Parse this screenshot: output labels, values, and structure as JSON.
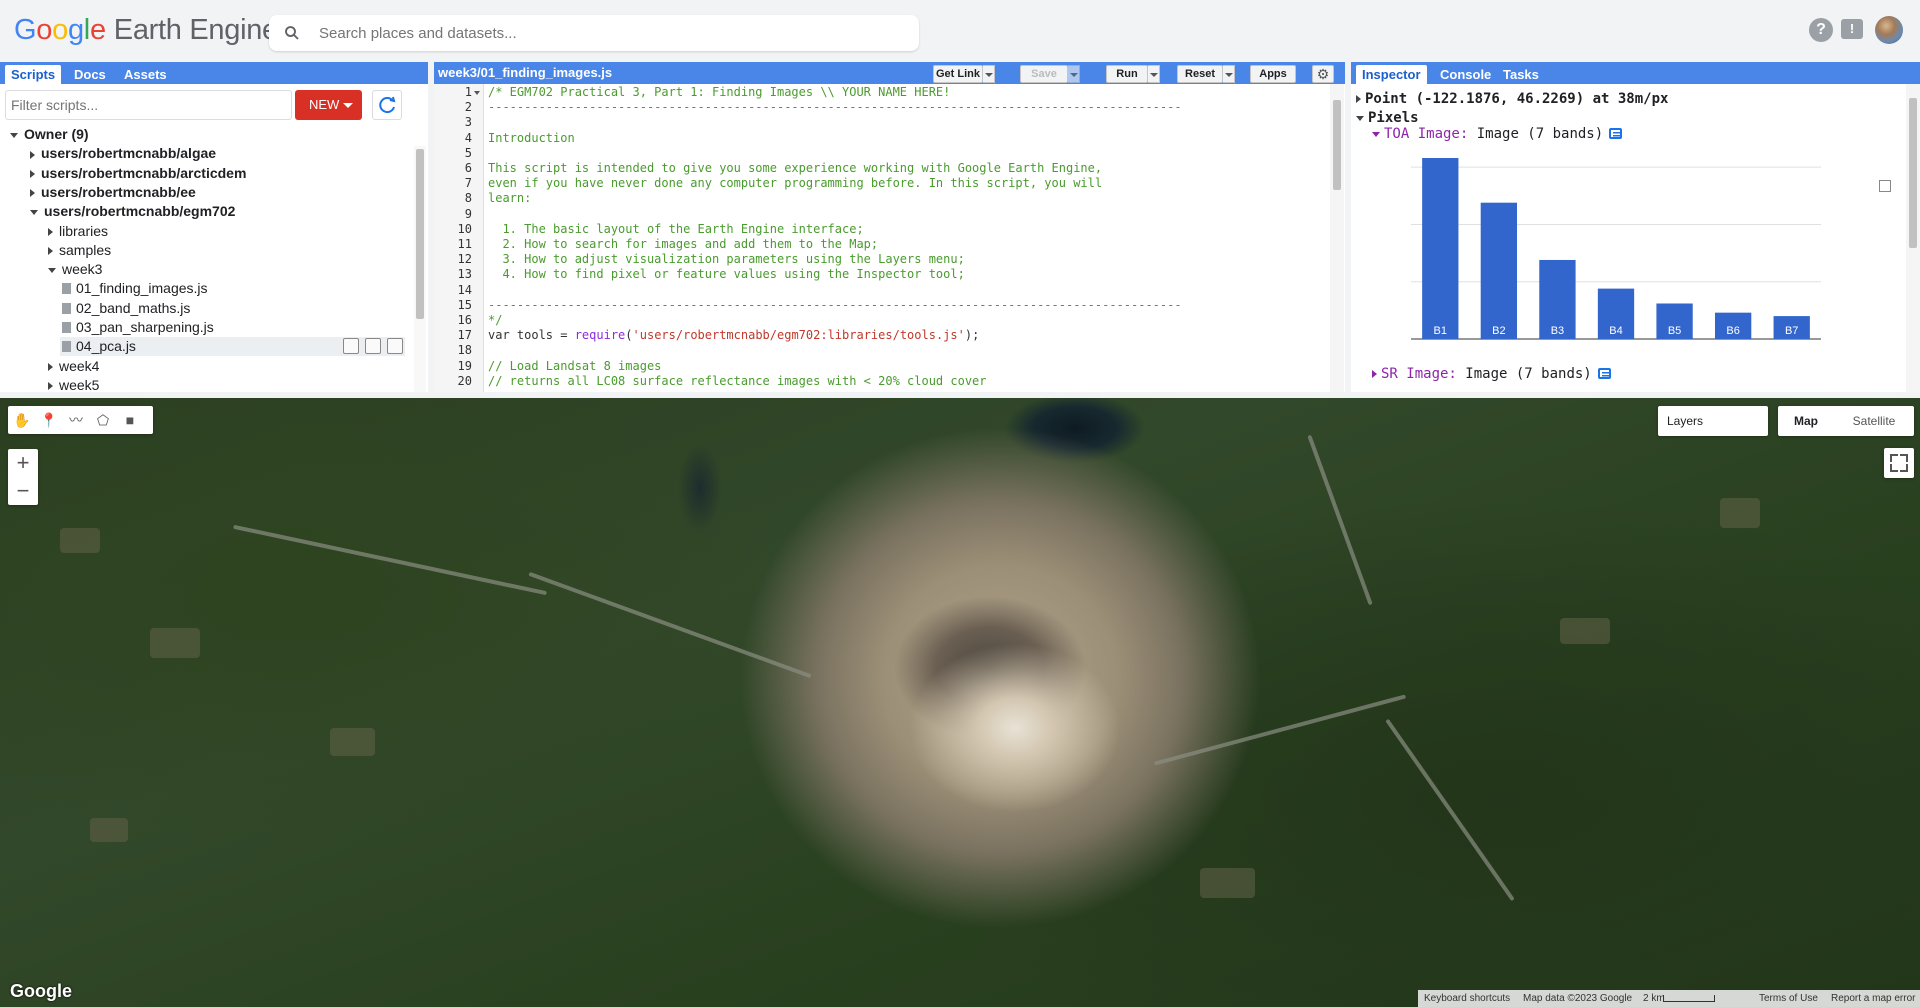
{
  "header": {
    "logo_google": [
      "G",
      "o",
      "o",
      "g",
      "l",
      "e"
    ],
    "logo_product": "Earth Engine",
    "search_placeholder": "Search places and datasets..."
  },
  "left_panel": {
    "tabs": [
      "Scripts",
      "Docs",
      "Assets"
    ],
    "filter_placeholder": "Filter scripts...",
    "new_label": "NEW",
    "tree": [
      {
        "label": "Owner (9)",
        "level": 0,
        "expanded": true,
        "bold": true
      },
      {
        "label": "users/robertmcnabb/algae",
        "level": 1,
        "expanded": false,
        "bold": true
      },
      {
        "label": "users/robertmcnabb/arcticdem",
        "level": 1,
        "expanded": false,
        "bold": true
      },
      {
        "label": "users/robertmcnabb/ee",
        "level": 1,
        "expanded": false,
        "bold": true
      },
      {
        "label": "users/robertmcnabb/egm702",
        "level": 1,
        "expanded": true,
        "bold": true
      },
      {
        "label": "libraries",
        "level": 2,
        "expanded": false
      },
      {
        "label": "samples",
        "level": 2,
        "expanded": false
      },
      {
        "label": "week3",
        "level": 2,
        "expanded": true
      },
      {
        "label": "01_finding_images.js",
        "level": 3,
        "file": true,
        "selected": true
      },
      {
        "label": "02_band_maths.js",
        "level": 3,
        "file": true
      },
      {
        "label": "03_pan_sharpening.js",
        "level": 3,
        "file": true
      },
      {
        "label": "04_pca.js",
        "level": 3,
        "file": true
      },
      {
        "label": "week4",
        "level": 2,
        "expanded": false
      },
      {
        "label": "week5",
        "level": 2,
        "expanded": false
      }
    ]
  },
  "editor": {
    "file_title": "week3/01_finding_images.js",
    "buttons": {
      "get_link": "Get Link",
      "save": "Save",
      "run": "Run",
      "reset": "Reset",
      "apps": "Apps"
    },
    "lines": [
      [
        {
          "t": "/* EGM702 Practical 3, Part 1: Finding Images \\\\ YOUR NAME HERE!",
          "c": "cm"
        }
      ],
      [
        {
          "t": "------------------------------------------------------------------------------------------------",
          "c": "cm"
        }
      ],
      [],
      [
        {
          "t": "Introduction",
          "c": "cm"
        }
      ],
      [],
      [
        {
          "t": "This script is intended to give you some experience working with Google Earth Engine,",
          "c": "cm"
        }
      ],
      [
        {
          "t": "even if you have never done any computer programming before. In this script, you will",
          "c": "cm"
        }
      ],
      [
        {
          "t": "learn:",
          "c": "cm"
        }
      ],
      [],
      [
        {
          "t": "  1. The basic layout of the Earth Engine interface;",
          "c": "cm"
        }
      ],
      [
        {
          "t": "  2. How to search for images and add them to the Map;",
          "c": "cm"
        }
      ],
      [
        {
          "t": "  3. How to adjust visualization parameters using the Layers menu;",
          "c": "cm"
        }
      ],
      [
        {
          "t": "  4. How to find pixel or feature values using the Inspector tool;",
          "c": "cm"
        }
      ],
      [],
      [
        {
          "t": "------------------------------------------------------------------------------------------------",
          "c": "cm"
        }
      ],
      [
        {
          "t": "*/",
          "c": "cm"
        }
      ],
      [
        {
          "t": "var tools = ",
          "c": "kw"
        },
        {
          "t": "require",
          "c": "fn"
        },
        {
          "t": "(",
          "c": "kw"
        },
        {
          "t": "'users/robertmcnabb/egm702:libraries/tools.js'",
          "c": "str"
        },
        {
          "t": ");",
          "c": "kw"
        }
      ],
      [],
      [
        {
          "t": "// Load Landsat 8 images",
          "c": "cm"
        }
      ],
      [
        {
          "t": "// returns all LC08 surface reflectance images with < 20% cloud cover",
          "c": "cm"
        }
      ]
    ]
  },
  "right_panel": {
    "tabs": [
      "Inspector",
      "Console",
      "Tasks"
    ],
    "point_label": "Point (-122.1876, 46.2269) at 38m/px",
    "pixels_label": "Pixels",
    "toa_name": "TOA Image:",
    "toa_desc": "Image (7 bands)",
    "sr_name": "SR Image:",
    "sr_desc": "Image (7 bands)"
  },
  "chart_data": {
    "type": "bar",
    "categories": [
      "B1",
      "B2",
      "B3",
      "B4",
      "B5",
      "B6",
      "B7"
    ],
    "values": [
      0.158,
      0.119,
      0.069,
      0.044,
      0.031,
      0.023,
      0.02
    ],
    "ylim": [
      0,
      0.165
    ],
    "color": "#3366cc",
    "grid": true
  },
  "map": {
    "layers_label": "Layers",
    "map_types": [
      "Map",
      "Satellite"
    ],
    "google_logo": "Google",
    "attribution": {
      "shortcuts": "Keyboard shortcuts",
      "data": "Map data ©2023 Google",
      "scale": "2 km",
      "terms": "Terms of Use",
      "report": "Report a map error"
    }
  }
}
